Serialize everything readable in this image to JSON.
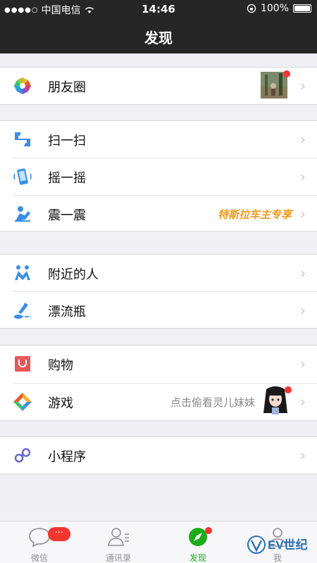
{
  "status_bar": {
    "carrier": "中国电信",
    "time": "14:46",
    "battery": "100%"
  },
  "nav": {
    "title": "发现"
  },
  "rows": {
    "moments": {
      "label": "朋友圈",
      "icon": "moments-aperture-icon"
    },
    "scan": {
      "label": "扫一扫",
      "icon": "scan-icon"
    },
    "shake": {
      "label": "摇一摇",
      "icon": "shake-phone-icon"
    },
    "vibrate": {
      "label": "震一震",
      "subtitle": "特斯拉车主专享",
      "icon": "vibrate-icon"
    },
    "nearby": {
      "label": "附近的人",
      "icon": "people-nearby-icon"
    },
    "bottle": {
      "label": "漂流瓶",
      "icon": "drift-bottle-icon"
    },
    "shopping": {
      "label": "购物",
      "icon": "shopping-bag-icon"
    },
    "games": {
      "label": "游戏",
      "subtitle": "点击偷看灵儿妹妹",
      "icon": "games-diamond-icon"
    },
    "miniprogram": {
      "label": "小程序",
      "icon": "mini-program-icon"
    }
  },
  "tabs": [
    {
      "label": "微信",
      "badge": "···"
    },
    {
      "label": "通讯录"
    },
    {
      "label": "发现",
      "active": true
    },
    {
      "label": "我"
    }
  ],
  "watermark": {
    "text": "EV世纪"
  },
  "colors": {
    "accent": "#1aad19",
    "badge": "#f43530",
    "orange": "#f09b21",
    "bar": "#262626"
  }
}
